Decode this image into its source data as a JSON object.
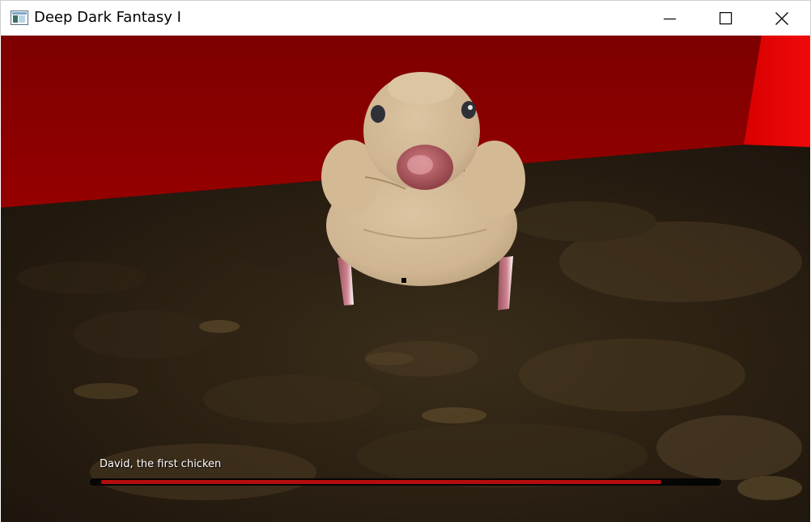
{
  "window": {
    "title": "Deep Dark Fantasy I",
    "icon": "app-window-icon",
    "controls": [
      "minimize-icon",
      "maximize-icon",
      "close-icon"
    ]
  },
  "scene": {
    "wall_color": "#8e0000",
    "floor_color": "#2a2013",
    "creature": {
      "body_color": "#d5bc98",
      "beak_color": "#b85f66",
      "leg_color": "#bf727f"
    }
  },
  "hud": {
    "target_name": "David, the first chicken",
    "health_fraction": 0.92,
    "health_color": "#b50d0d",
    "track_color": "#050505"
  }
}
